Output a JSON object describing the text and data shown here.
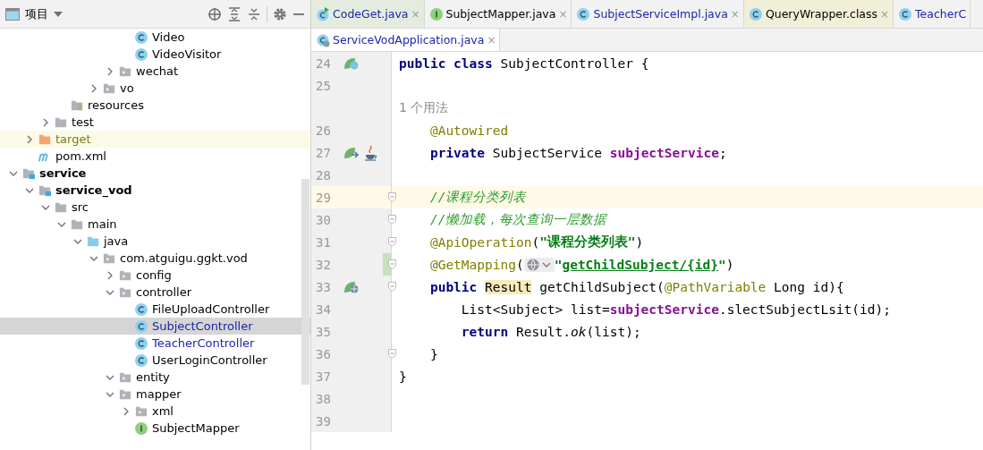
{
  "project_panel": {
    "title": "项目",
    "tree": [
      {
        "children": [
          {
            "children": [
              {
                "children": [
                  {
                    "children": [
                      {
                        "children": [
                          {
                            "children": [
                              {
                                "children": [
                                  {
                                    "label": "Video",
                                    "kind": "class",
                                    "modified": false,
                                    "selected": false
                                  },
                                  {
                                    "label": "VideoVisitor",
                                    "kind": "class",
                                    "modified": false,
                                    "selected": false
                                  }
                                ]
                              },
                              {
                                "label": "wechat",
                                "kind": "package",
                                "expanded": false,
                                "modified": false,
                                "selected": false
                              }
                            ]
                          },
                          {
                            "label": "vo",
                            "kind": "package",
                            "expanded": false,
                            "modified": false,
                            "selected": false
                          }
                        ]
                      }
                    ]
                  },
                  {
                    "label": "resources",
                    "kind": "resources",
                    "modified": false,
                    "selected": false
                  }
                ]
              },
              {
                "label": "test",
                "kind": "folder",
                "expanded": false,
                "modified": false,
                "selected": false
              }
            ]
          },
          {
            "label": "target",
            "kind": "excluded",
            "expanded": false,
            "modified": false,
            "selected": false
          },
          {
            "label": "pom.xml",
            "kind": "maven",
            "modified": false,
            "selected": false
          }
        ]
      },
      {
        "label": "service",
        "kind": "module",
        "expanded": true,
        "modified": false,
        "selected": false,
        "children": [
          {
            "label": "service_vod",
            "kind": "module",
            "expanded": true,
            "modified": false,
            "selected": false,
            "children": [
              {
                "label": "src",
                "kind": "folder",
                "expanded": true,
                "modified": false,
                "selected": false,
                "children": [
                  {
                    "label": "main",
                    "kind": "folder",
                    "expanded": true,
                    "modified": false,
                    "selected": false,
                    "children": [
                      {
                        "label": "java",
                        "kind": "source",
                        "expanded": true,
                        "modified": false,
                        "selected": false,
                        "children": [
                          {
                            "label": "com.atguigu.ggkt.vod",
                            "kind": "package",
                            "expanded": true,
                            "modified": false,
                            "selected": false,
                            "children": [
                              {
                                "label": "config",
                                "kind": "package",
                                "expanded": false,
                                "modified": false,
                                "selected": false
                              },
                              {
                                "label": "controller",
                                "kind": "package",
                                "expanded": true,
                                "modified": false,
                                "selected": false,
                                "children": [
                                  {
                                    "label": "FileUploadController",
                                    "kind": "class",
                                    "modified": false,
                                    "selected": false
                                  },
                                  {
                                    "label": "SubjectController",
                                    "kind": "class",
                                    "modified": true,
                                    "selected": true
                                  },
                                  {
                                    "label": "TeacherController",
                                    "kind": "class",
                                    "modified": true,
                                    "selected": false
                                  },
                                  {
                                    "label": "UserLoginController",
                                    "kind": "class",
                                    "modified": false,
                                    "selected": false
                                  }
                                ]
                              },
                              {
                                "label": "entity",
                                "kind": "package",
                                "expanded": true,
                                "modified": false,
                                "selected": false
                              },
                              {
                                "label": "mapper",
                                "kind": "package",
                                "expanded": true,
                                "modified": false,
                                "selected": false,
                                "children": [
                                  {
                                    "label": "xml",
                                    "kind": "package",
                                    "expanded": false,
                                    "modified": false,
                                    "selected": false
                                  },
                                  {
                                    "label": "SubjectMapper",
                                    "kind": "interface",
                                    "modified": false,
                                    "selected": false
                                  }
                                ]
                              }
                            ]
                          }
                        ]
                      }
                    ]
                  }
                ]
              }
            ]
          }
        ]
      }
    ]
  },
  "tab_rows": [
    [
      {
        "label": "CodeGet.java",
        "kind": "runnable",
        "color": "#e4ecdf",
        "modified": true,
        "close": "×"
      },
      {
        "label": "SubjectMapper.java",
        "kind": "interface",
        "color": "#f2f2f2",
        "modified": false,
        "close": "×"
      },
      {
        "label": "SubjectServiceImpl.java",
        "kind": "class",
        "color": "#f2f2f2",
        "modified": true,
        "close": "×"
      },
      {
        "label": "QueryWrapper.class",
        "kind": "class",
        "color": "#f1efd8",
        "modified": false,
        "close": "×"
      },
      {
        "label": "TeacherC",
        "kind": "class",
        "color": "#f2f2f2",
        "modified": true
      }
    ],
    [
      {
        "label": "ServiceVodApplication.java",
        "kind": "application",
        "color": "#ffffff",
        "modified": true,
        "close": "×"
      }
    ]
  ],
  "editor": {
    "lines": [
      {
        "number": "24",
        "gutter": [
          {
            "kind": "bean"
          }
        ],
        "fold": false,
        "current": false,
        "segments": [
          {
            "kind": "keyword",
            "text": "public class "
          },
          {
            "kind": "plain",
            "text": "SubjectController {"
          }
        ]
      },
      {
        "number": "25",
        "fold": false,
        "current": false
      },
      {
        "fold": false,
        "current": false,
        "segments": [
          {
            "kind": "hint",
            "text": "1 个用法"
          }
        ]
      },
      {
        "number": "26",
        "fold": false,
        "current": false,
        "segments": [
          {
            "kind": "annotation",
            "text": "    @Autowired"
          }
        ]
      },
      {
        "number": "27",
        "gutter": [
          {
            "kind": "bean-nav"
          },
          {
            "kind": "java"
          }
        ],
        "fold": false,
        "current": false,
        "segments": [
          {
            "kind": "keyword",
            "text": "    private "
          },
          {
            "kind": "plain",
            "text": "SubjectService "
          },
          {
            "kind": "field",
            "text": "subjectService"
          },
          {
            "kind": "plain",
            "text": ";"
          }
        ]
      },
      {
        "number": "28",
        "fold": false,
        "current": false
      },
      {
        "number": "29",
        "fold": true,
        "current": true,
        "segments": [
          {
            "kind": "comment",
            "text": "    //课程分类列表"
          }
        ]
      },
      {
        "number": "30",
        "fold": true,
        "current": false,
        "segments": [
          {
            "kind": "comment",
            "text": "    //懒加载，每次查询一层数据"
          }
        ]
      },
      {
        "number": "31",
        "fold": true,
        "current": false,
        "segments": [
          {
            "kind": "annotation",
            "text": "    @ApiOperation"
          },
          {
            "kind": "plain",
            "text": "("
          },
          {
            "kind": "string",
            "text": "\"课程分类列表\""
          },
          {
            "kind": "plain",
            "text": ")"
          }
        ]
      },
      {
        "number": "32",
        "gutter": [
          {
            "kind": "changed"
          }
        ],
        "fold": true,
        "current": false,
        "segments": [
          {
            "kind": "annotation",
            "text": "    @GetMapping"
          },
          {
            "kind": "plain",
            "text": "("
          },
          {
            "kind": "web-inlay"
          },
          {
            "kind": "string",
            "text": "\""
          },
          {
            "kind": "url",
            "text": "getChildSubject/{id}"
          },
          {
            "kind": "string",
            "text": "\""
          },
          {
            "kind": "plain",
            "text": ")"
          }
        ]
      },
      {
        "number": "33",
        "gutter": [
          {
            "kind": "web"
          }
        ],
        "fold": true,
        "current": false,
        "segments": [
          {
            "kind": "keyword",
            "text": "    public "
          },
          {
            "kind": "usage",
            "text": "Result"
          },
          {
            "kind": "plain",
            "text": " getChildSubject("
          },
          {
            "kind": "annotation",
            "text": "@PathVariable"
          },
          {
            "kind": "plain",
            "text": " Long id){"
          }
        ]
      },
      {
        "number": "34",
        "fold": false,
        "current": false,
        "segments": [
          {
            "kind": "plain",
            "text": "        List<Subject> list="
          },
          {
            "kind": "field",
            "text": "subjectService"
          },
          {
            "kind": "plain",
            "text": ".slectSubjectLsit(id);"
          }
        ]
      },
      {
        "number": "35",
        "fold": false,
        "current": false,
        "segments": [
          {
            "kind": "keyword",
            "text": "        return "
          },
          {
            "kind": "plain",
            "text": "Result."
          },
          {
            "kind": "italic",
            "text": "ok"
          },
          {
            "kind": "plain",
            "text": "(list);"
          }
        ]
      },
      {
        "number": "36",
        "fold": true,
        "current": false,
        "segments": [
          {
            "kind": "plain",
            "text": "    }"
          }
        ]
      },
      {
        "number": "37",
        "fold": false,
        "current": false,
        "segments": [
          {
            "kind": "plain",
            "text": "}"
          }
        ]
      },
      {
        "number": "38",
        "fold": false,
        "current": false
      },
      {
        "number": "39",
        "fold": false,
        "current": false
      }
    ]
  }
}
